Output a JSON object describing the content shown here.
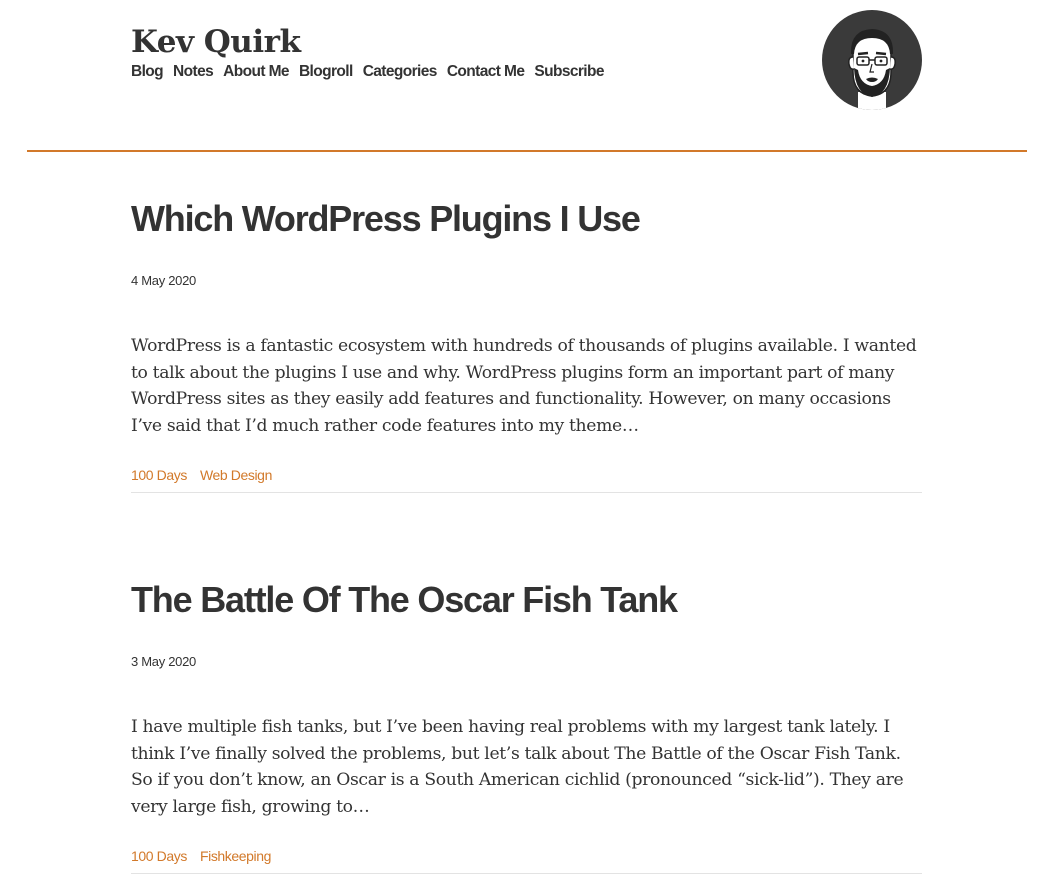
{
  "header": {
    "site_title": "Kev Quirk",
    "nav": [
      "Blog",
      "Notes",
      "About Me",
      "Blogroll",
      "Categories",
      "Contact Me",
      "Subscribe"
    ],
    "avatar_icon": "avatar-illustration"
  },
  "colors": {
    "accent": "#d2792a",
    "text": "#333333",
    "avatar_bg": "#3a3a3a"
  },
  "posts": [
    {
      "title": "Which WordPress Plugins I Use",
      "date": "4 May 2020",
      "excerpt": "WordPress is a fantastic ecosystem with hundreds of thousands of plugins available. I wanted to talk about the plugins I use and why. WordPress plugins form an important part of many WordPress sites as they easily add features and functionality. However, on many occasions I’ve said that I’d much rather code features into my theme…",
      "tags": [
        "100 Days",
        "Web Design"
      ]
    },
    {
      "title": "The Battle Of The Oscar Fish Tank",
      "date": "3 May 2020",
      "excerpt": "I have multiple fish tanks, but I’ve been having real problems with my largest tank lately. I think I’ve finally solved the problems, but let’s talk about The Battle of the Oscar Fish Tank. So if you don’t know, an Oscar is a South American cichlid (pronounced “sick-lid”). They are very large fish, growing to…",
      "tags": [
        "100 Days",
        "Fishkeeping"
      ]
    }
  ]
}
